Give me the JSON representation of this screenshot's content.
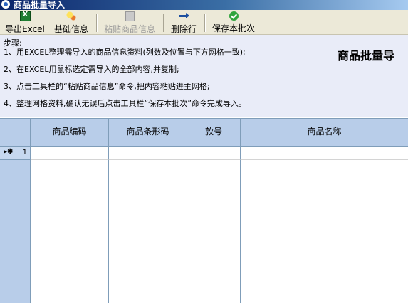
{
  "window": {
    "title": "商品批量导入"
  },
  "toolbar": {
    "export_excel": {
      "label": "导出Excel",
      "icon": "excel-icon"
    },
    "base_info": {
      "label": "基础信息",
      "icon": "info-icon"
    },
    "paste_info": {
      "label": "粘贴商品信息",
      "icon": "paste-icon",
      "enabled": false
    },
    "delete_row": {
      "label": "删除行",
      "icon": "delete-row-icon"
    },
    "save_batch": {
      "label": "保存本批次",
      "icon": "check-icon"
    }
  },
  "instructions": {
    "heading": "步骤:",
    "steps": [
      "1、用EXCEL整理需导入的商品信息资料(列数及位置与下方网格一致);",
      "2、在EXCEL用鼠标选定需导入的全部内容,并复制;",
      "3、点击工具栏的“粘贴商品信息”命令,把内容粘贴进主网格;",
      "4、整理网格资料,确认无误后点击工具栏“保存本批次”命令完成导入。"
    ],
    "banner": "商品批量导"
  },
  "grid": {
    "columns": [
      "商品编码",
      "商品条形码",
      "款号",
      "商品名称"
    ],
    "rows": [
      {
        "indicator": "▸✱",
        "number": "1",
        "cells": [
          "",
          "",
          "",
          ""
        ]
      }
    ]
  }
}
